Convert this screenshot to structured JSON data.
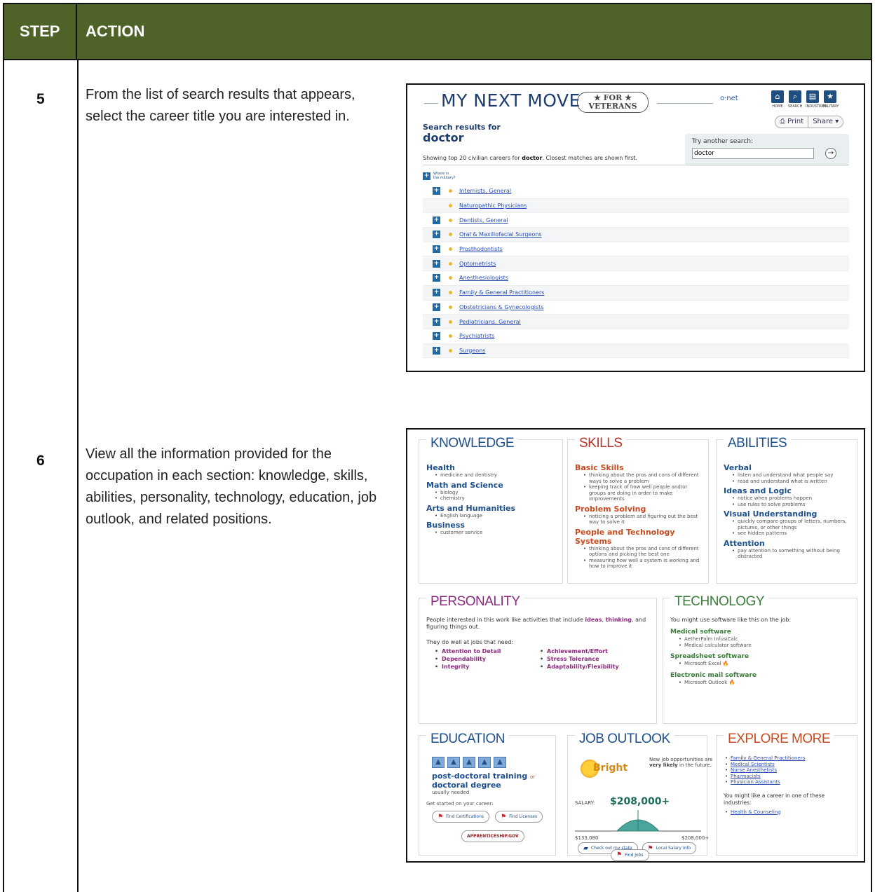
{
  "header": {
    "step": "STEP",
    "action": "ACTION"
  },
  "steps": [
    {
      "number": "5",
      "text": "From the list of search results that appears, select the career title you are interested in."
    },
    {
      "number": "6",
      "text": "View all the information provided for the occupation in each section: knowledge, skills, abilities, personality, technology, education, job outlook, and related positions."
    }
  ],
  "screenshot1": {
    "logo_text": "MY NEXT MOVE",
    "badge_line1": "★ FOR ★",
    "badge_line2": "VETERANS",
    "onet": "o·net",
    "nav_icons": [
      {
        "icon": "home-icon",
        "glyph": "⌂",
        "label": "HOME"
      },
      {
        "icon": "search-icon",
        "glyph": "⌕",
        "label": "SEARCH"
      },
      {
        "icon": "industries-icon",
        "glyph": "▤",
        "label": "INDUSTRIES"
      },
      {
        "icon": "military-icon",
        "glyph": "★",
        "label": "MILITARY"
      }
    ],
    "print_label": "⎙ Print",
    "share_label": "Share ▾",
    "results_for_label": "Search results for",
    "search_term": "doctor",
    "try_another_label": "Try another search:",
    "search_value": "doctor",
    "go_glyph": "→",
    "showing_prefix": "Showing top 20 civilian careers for ",
    "showing_term": "doctor",
    "showing_suffix": ". Closest matches are shown first.",
    "military_label_line1": "Where in",
    "military_label_line2": "the military?",
    "results": [
      {
        "title": "Internists, General",
        "has_plus": true
      },
      {
        "title": "Naturopathic Physicians",
        "has_plus": false
      },
      {
        "title": "Dentists, General",
        "has_plus": true
      },
      {
        "title": "Oral & Maxillofacial Surgeons",
        "has_plus": true
      },
      {
        "title": "Prosthodontists",
        "has_plus": true
      },
      {
        "title": "Optometrists",
        "has_plus": true
      },
      {
        "title": "Anesthesiologists",
        "has_plus": true
      },
      {
        "title": "Family & General Practitioners",
        "has_plus": true
      },
      {
        "title": "Obstetricians & Gynecologists",
        "has_plus": true
      },
      {
        "title": "Pediatricians, General",
        "has_plus": true
      },
      {
        "title": "Psychiatrists",
        "has_plus": true
      },
      {
        "title": "Surgeons",
        "has_plus": true
      }
    ]
  },
  "screenshot2": {
    "knowledge": {
      "title": "KNOWLEDGE",
      "groups": [
        {
          "heading": "Health",
          "items": [
            "medicine and dentistry"
          ]
        },
        {
          "heading": "Math and Science",
          "items": [
            "biology",
            "chemistry"
          ]
        },
        {
          "heading": "Arts and Humanities",
          "items": [
            "English language"
          ]
        },
        {
          "heading": "Business",
          "items": [
            "customer service"
          ]
        }
      ]
    },
    "skills": {
      "title": "SKILLS",
      "groups": [
        {
          "heading": "Basic Skills",
          "items": [
            "thinking about the pros and cons of different ways to solve a problem",
            "keeping track of how well people and/or groups are doing in order to make improvements"
          ]
        },
        {
          "heading": "Problem Solving",
          "items": [
            "noticing a problem and figuring out the best way to solve it"
          ]
        },
        {
          "heading": "People and Technology Systems",
          "items": [
            "thinking about the pros and cons of different options and picking the best one",
            "measuring how well a system is working and how to improve it"
          ]
        }
      ]
    },
    "abilities": {
      "title": "ABILITIES",
      "groups": [
        {
          "heading": "Verbal",
          "items": [
            "listen and understand what people say",
            "read and understand what is written"
          ]
        },
        {
          "heading": "Ideas and Logic",
          "items": [
            "notice when problems happen",
            "use rules to solve problems"
          ]
        },
        {
          "heading": "Visual Understanding",
          "items": [
            "quickly compare groups of letters, numbers, pictures, or other things",
            "see hidden patterns"
          ]
        },
        {
          "heading": "Attention",
          "items": [
            "pay attention to something without being distracted"
          ]
        }
      ]
    },
    "personality": {
      "title": "PERSONALITY",
      "intro_prefix": "People interested in this work like activities that include ",
      "intro_hl1": "ideas",
      "intro_mid": ", ",
      "intro_hl2": "thinking",
      "intro_suffix": ", and figuring things out.",
      "needs_label": "They do well at jobs that need:",
      "col1": [
        "Attention to Detail",
        "Dependability",
        "Integrity"
      ],
      "col2": [
        "Achievement/Effort",
        "Stress Tolerance",
        "Adaptability/Flexibility"
      ]
    },
    "technology": {
      "title": "TECHNOLOGY",
      "intro": "You might use software like this on the job:",
      "groups": [
        {
          "heading": "Medical software",
          "items": [
            "AetherPalm InfusiCalc",
            "Medical calculator software"
          ]
        },
        {
          "heading": "Spreadsheet software",
          "items": [
            "Microsoft Excel 🔥"
          ]
        },
        {
          "heading": "Electronic mail software",
          "items": [
            "Microsoft Outlook 🔥"
          ]
        }
      ]
    },
    "education": {
      "title": "EDUCATION",
      "degree": "post-doctoral training",
      "or_label": "or",
      "degree2": "doctoral degree",
      "usually": "usually needed",
      "started": "Get started on your career:",
      "btn_cert": "Find Certifications",
      "btn_lic": "Find Licenses",
      "btn_appr": "APPRENTICESHIP.GOV"
    },
    "outlook": {
      "title": "JOB OUTLOOK",
      "rating": "Bright",
      "text_prefix": "New job opportunities are ",
      "text_bold": "very likely",
      "text_suffix": " in the future.",
      "salary_label": "SALARY:",
      "salary_value": "$208,000+",
      "salary_min": "$133,080",
      "salary_max": "$208,000+",
      "btn_state": "Check out my state",
      "btn_local": "Local Salary Info",
      "btn_jobs": "Find Jobs"
    },
    "explore": {
      "title": "EXPLORE MORE",
      "links": [
        "Family & General Practitioners",
        "Medical Scientists",
        "Nurse Anesthetists",
        "Pharmacists",
        "Physician Assistants"
      ],
      "industry_intro": "You might like a career in one of these industries:",
      "industries": [
        "Health & Counseling"
      ]
    }
  }
}
